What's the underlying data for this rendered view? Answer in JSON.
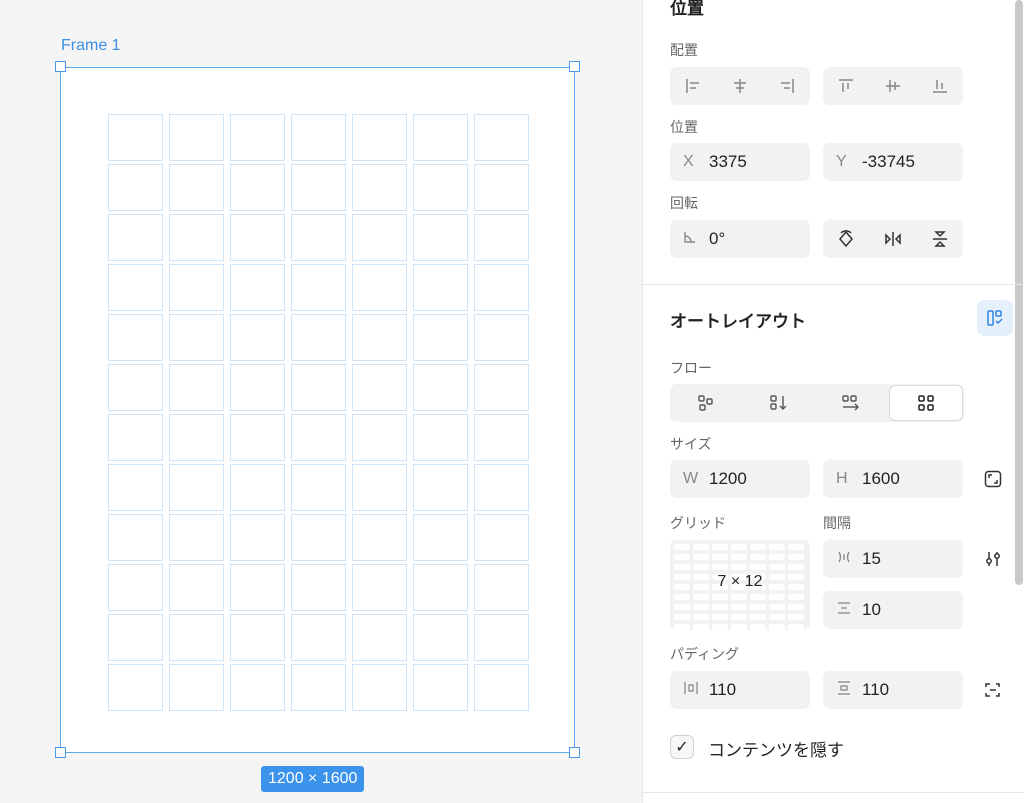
{
  "canvas": {
    "frame_label": "Frame 1",
    "size_tag": "1200 × 1600",
    "grid_columns": 7,
    "grid_rows": 12
  },
  "panel": {
    "position_section": {
      "title": "位置",
      "align_label": "配置",
      "position_label": "位置",
      "x_prefix": "X",
      "x_value": "3375",
      "y_prefix": "Y",
      "y_value": "-33745",
      "rotation_label": "回転",
      "rotation_value": "0°"
    },
    "auto_layout": {
      "title": "オートレイアウト",
      "flow_label": "フロー",
      "flow_active": "grid",
      "size_label": "サイズ",
      "w_prefix": "W",
      "w_value": "1200",
      "h_prefix": "H",
      "h_value": "1600",
      "grid_label": "グリッド",
      "grid_value": "7 × 12",
      "spacing_label": "間隔",
      "gap_horizontal": "15",
      "gap_vertical": "10",
      "padding_label": "パディング",
      "padding_horizontal": "110",
      "padding_vertical": "110",
      "clip_label": "コンテンツを隠す",
      "clip_checked": true
    },
    "colors": {
      "accent": "#3b93ec",
      "frame_border": "#5ea7ef",
      "cell_border": "#cfe4f7"
    }
  }
}
